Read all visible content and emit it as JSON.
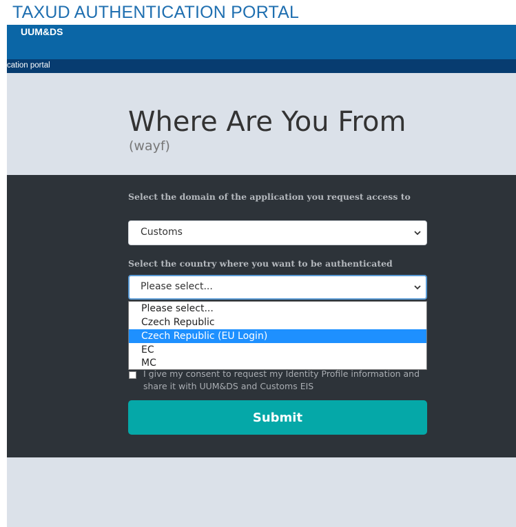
{
  "header": {
    "portal_title": "TAXUD AUTHENTICATION PORTAL",
    "app_name": "UUM&DS",
    "breadcrumb": "cation portal"
  },
  "main": {
    "heading": "Where Are You From",
    "subheading": "(wayf)"
  },
  "form": {
    "domain_label": "Select the domain of the application you request access to",
    "domain_value": "Customs",
    "country_label": "Select the country where you want to be authenticated",
    "country_value": "Please select...",
    "country_options": [
      "Please select...",
      "Czech Republic",
      "Czech Republic (EU Login)",
      "EC",
      "MC"
    ],
    "highlighted_option": "Czech Republic (EU Login)",
    "consent_text": "I give my consent to request my Identity Profile information and share it with UUM&DS and Customs EIS",
    "consent_checked": false,
    "submit_label": "Submit"
  },
  "colors": {
    "portal_title": "#1f6fb0",
    "app_bar": "#0b66a6",
    "breadcrumb_bar": "#073c70",
    "page_background": "#dbe1e9",
    "form_panel": "#2d3339",
    "submit_button": "#05a8a8",
    "option_highlight": "#1e90ff"
  },
  "icons": {
    "select_chevron": "chevron-down-icon"
  }
}
